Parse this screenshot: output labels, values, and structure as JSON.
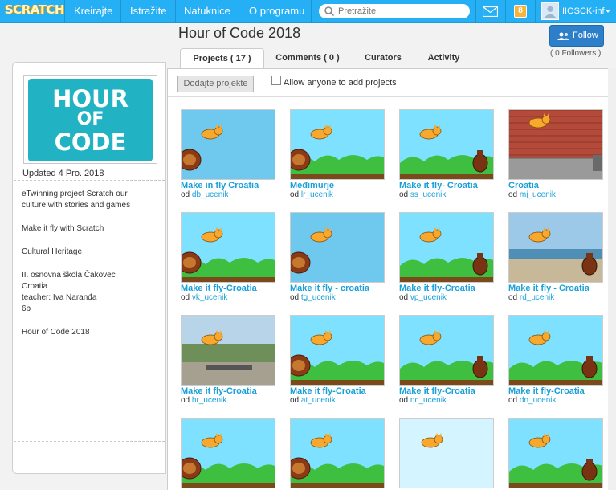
{
  "topbar": {
    "logo": "SCRATCH",
    "nav": [
      "Kreirajte",
      "Istražite",
      "Natuknice",
      "O programu"
    ],
    "search_placeholder": "Pretražite",
    "bag_label": "8",
    "username": "IIOSCK-inf"
  },
  "studio": {
    "title": "Hour of Code 2018",
    "follow_label": "Follow",
    "followers": "( 0 Followers )",
    "tabs": [
      "Projects ( 17 )",
      "Comments ( 0 )",
      "Curators",
      "Activity"
    ],
    "add_projects_label": "Dodajte projekte",
    "allow_label": "Allow anyone to add projects"
  },
  "left": {
    "thumb_text": [
      "HOUR",
      "OF",
      "CODE"
    ],
    "updated": "Updated 4 Pro. 2018",
    "description": [
      "eTwinning project Scratch our",
      "culture with stories and games",
      "Make it fly with Scratch",
      "Cultural Heritage",
      "II. osnovna škola Čakovec",
      "Croatia",
      "teacher: Iva Naranđa",
      "6b",
      "Hour of Code 2018"
    ]
  },
  "by": "od",
  "projects": [
    {
      "title": "Make in fly Croatia",
      "owner": "db_ucenik",
      "bg": "#6fc9ef",
      "scene": "sky"
    },
    {
      "title": "Međimurje",
      "owner": "lr_ucenik",
      "bg": "#7ee1ff",
      "scene": "hills"
    },
    {
      "title": "Make it fly- Croatia",
      "owner": "ss_ucenik",
      "bg": "#7ee1ff",
      "scene": "hills"
    },
    {
      "title": "Croatia",
      "owner": "mj_ucenik",
      "bg": "#b34a3a",
      "scene": "brick"
    },
    {
      "title": "Make it fly-Croatia",
      "owner": "vk_ucenik",
      "bg": "#7ee1ff",
      "scene": "hills"
    },
    {
      "title": "Make it fly - croatia",
      "owner": "tg_ucenik",
      "bg": "#6fc9ef",
      "scene": "sky"
    },
    {
      "title": "Make it fly-Croatia",
      "owner": "vp_ucenik",
      "bg": "#7ee1ff",
      "scene": "hills"
    },
    {
      "title": "Make it fly - Croatia",
      "owner": "rd_ucenik",
      "bg": "#9cc9e8",
      "scene": "beach"
    },
    {
      "title": "Make it fly-Croatia",
      "owner": "hr_ucenik",
      "bg": "#b8d4e8",
      "scene": "photo"
    },
    {
      "title": "Make it fly-Croatia",
      "owner": "at_ucenik",
      "bg": "#7ee1ff",
      "scene": "hills"
    },
    {
      "title": "Make it fly-Croatia",
      "owner": "nc_ucenik",
      "bg": "#7ee1ff",
      "scene": "hills"
    },
    {
      "title": "Make it fly-Croatia",
      "owner": "dn_ucenik",
      "bg": "#7ee1ff",
      "scene": "hills"
    },
    {
      "title": "",
      "owner": "",
      "bg": "#7ee1ff",
      "scene": "hills"
    },
    {
      "title": "",
      "owner": "",
      "bg": "#7ee1ff",
      "scene": "hills"
    },
    {
      "title": "",
      "owner": "",
      "bg": "#d4f4ff",
      "scene": "sky"
    },
    {
      "title": "",
      "owner": "",
      "bg": "#7ee1ff",
      "scene": "hills"
    }
  ]
}
